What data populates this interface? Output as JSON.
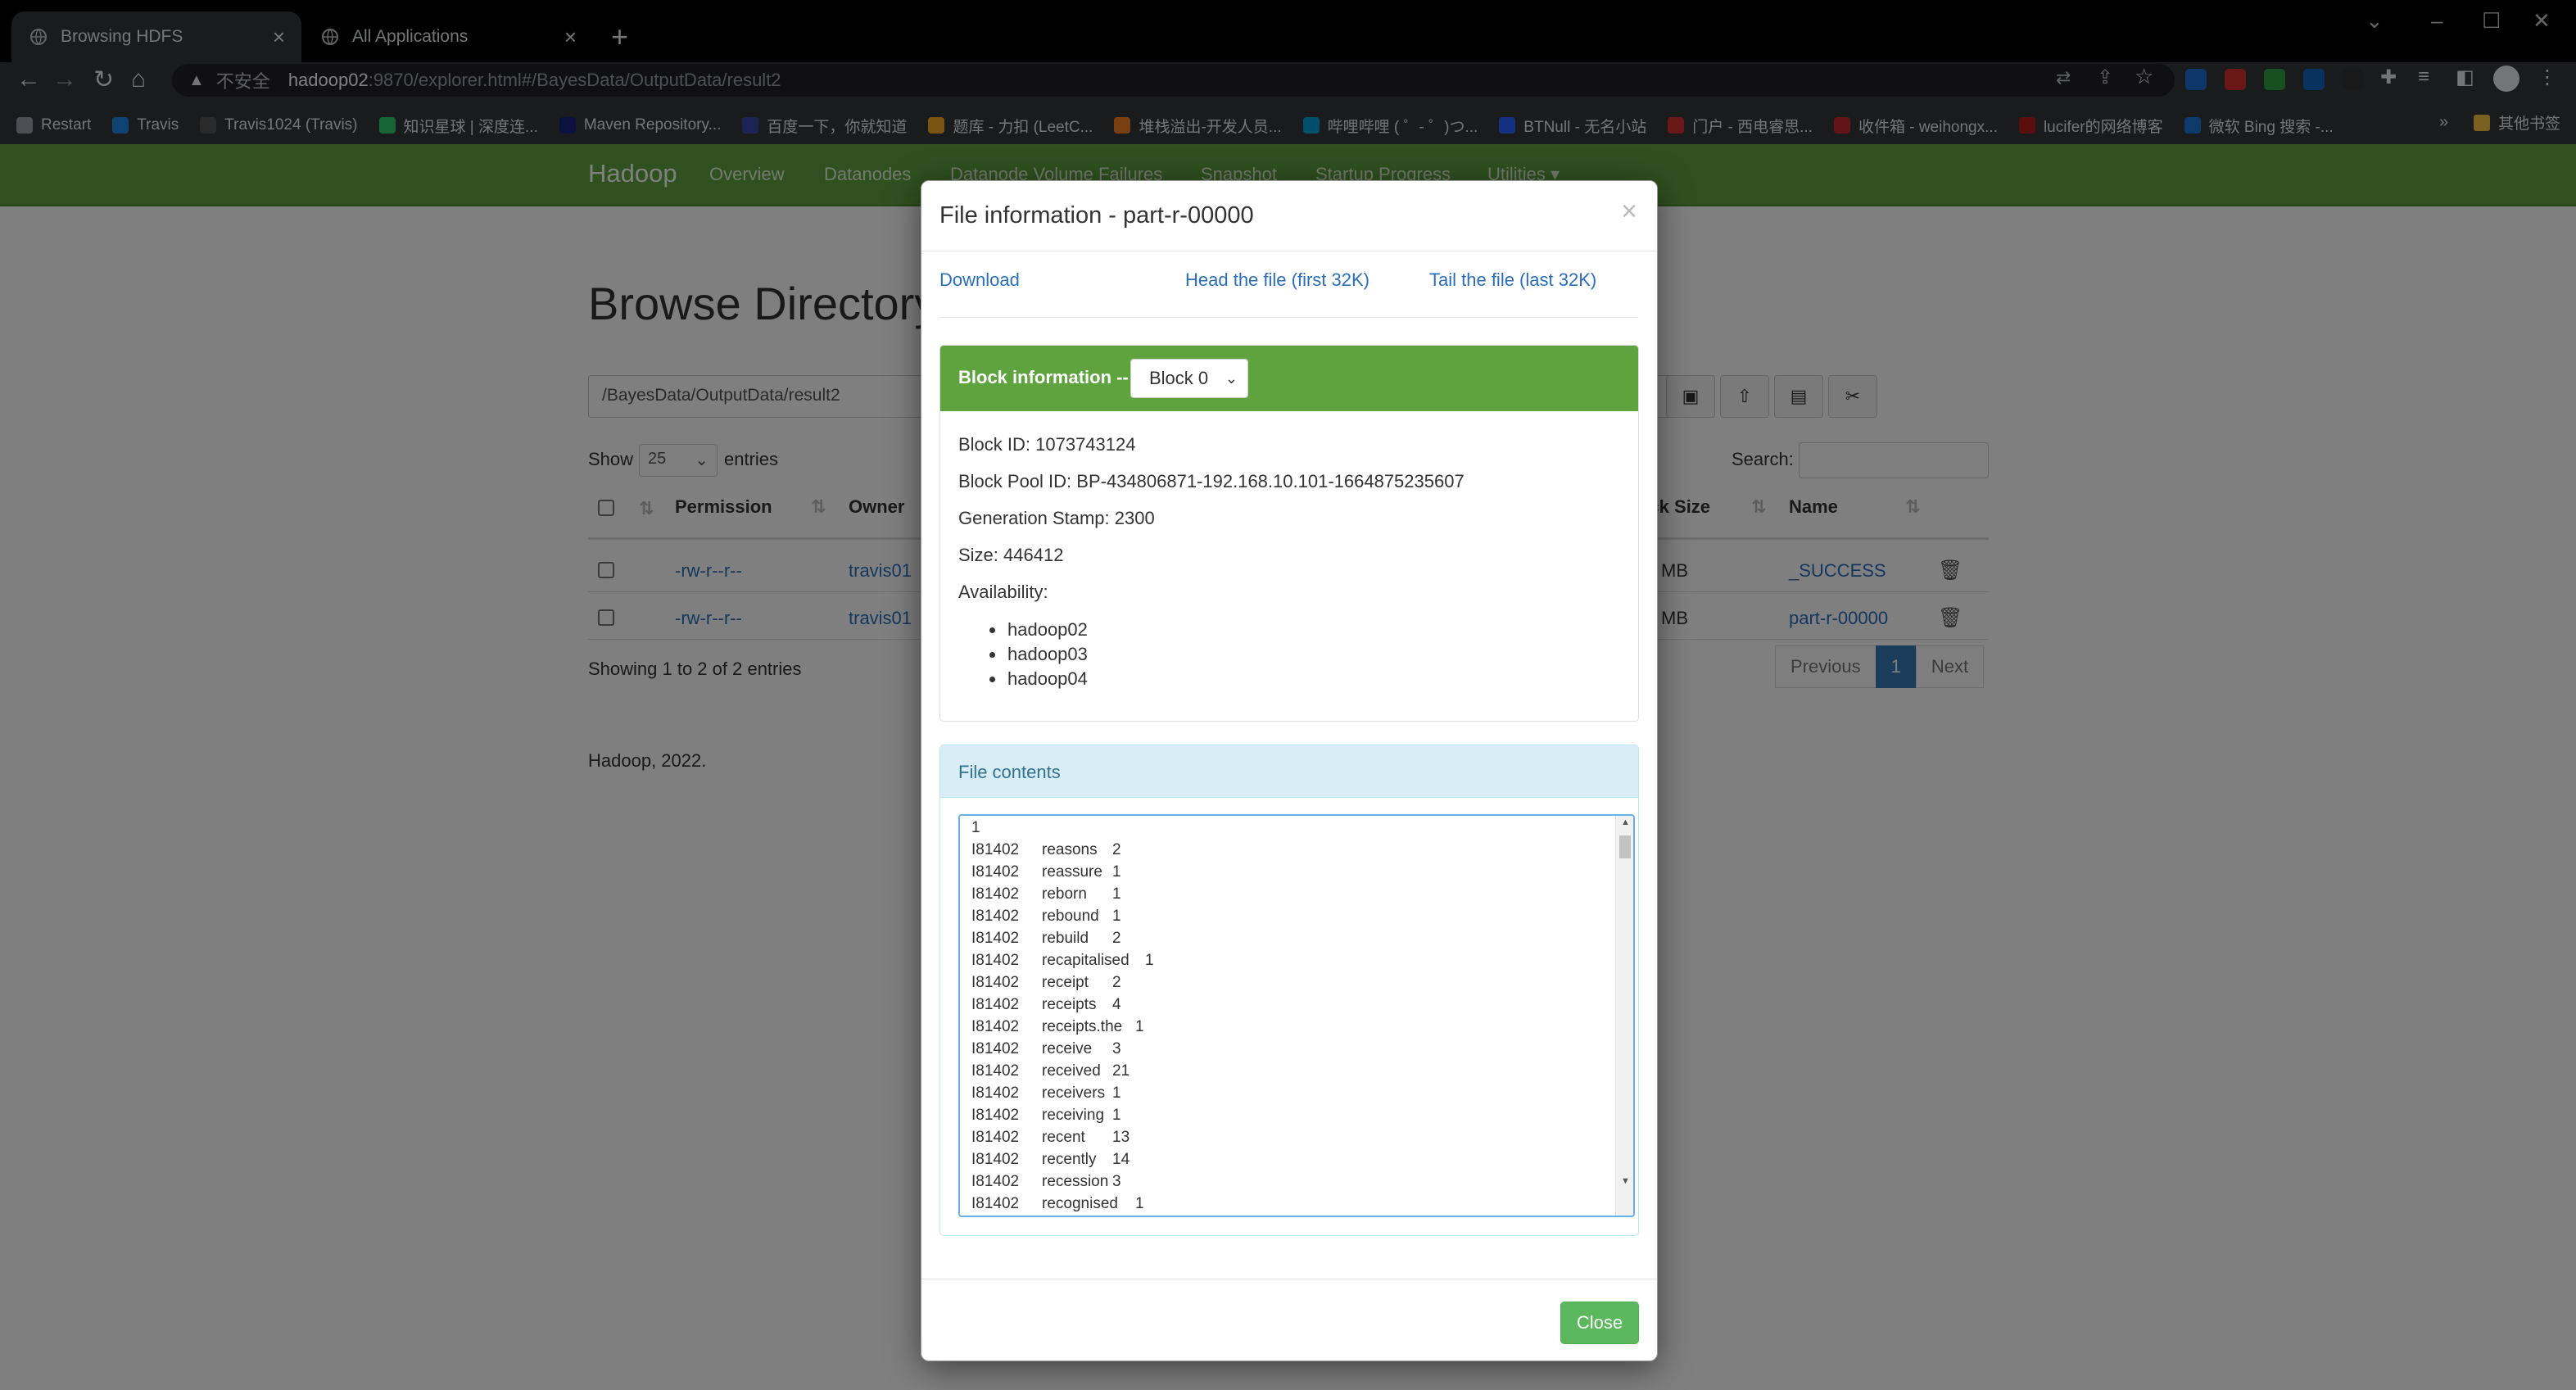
{
  "browser": {
    "tabs": [
      {
        "title": "Browsing HDFS",
        "active": true
      },
      {
        "title": "All Applications",
        "active": false
      }
    ],
    "address": {
      "security_label": "不安全",
      "host": "hadoop02",
      "path": ":9870/explorer.html#/BayesData/OutputData/result2"
    },
    "bookmarks": [
      {
        "label": "Restart",
        "color": "#9aa0a6"
      },
      {
        "label": "Travis",
        "color": "#1e88e5"
      },
      {
        "label": "Travis1024 (Travis)",
        "color": "#555555"
      },
      {
        "label": "知识星球 | 深度连...",
        "color": "#2ecc71"
      },
      {
        "label": "Maven Repository...",
        "color": "#1a237e"
      },
      {
        "label": "百度一下，你就知道",
        "color": "#3949ab"
      },
      {
        "label": "题库 - 力扣 (LeetC...",
        "color": "#f5a623"
      },
      {
        "label": "堆栈溢出-开发人员...",
        "color": "#f48024"
      },
      {
        "label": "哔哩哔哩 ( ゜- ゜)つ...",
        "color": "#00a1d6"
      },
      {
        "label": "BTNull - 无名小站",
        "color": "#2962ff"
      },
      {
        "label": "门户 - 西电睿思...",
        "color": "#d32f2f"
      },
      {
        "label": "收件箱 - weihongx...",
        "color": "#c62828"
      },
      {
        "label": "lucifer的网络博客",
        "color": "#b71c1c"
      },
      {
        "label": "微软 Bing 搜索 -...",
        "color": "#1976d2"
      }
    ],
    "other_bookmarks": "其他书签",
    "overflow": "»"
  },
  "hadoop": {
    "brand": "Hadoop",
    "nav": [
      "Overview",
      "Datanodes",
      "Datanode Volume Failures",
      "Snapshot",
      "Startup Progress",
      "Utilities ▾"
    ],
    "title": "Browse Directory",
    "path_value": "/BayesData/OutputData/result2",
    "show_label": "Show",
    "entries_value": "25",
    "entries_label": "entries",
    "search_label": "Search:",
    "columns": [
      "Permission",
      "Owner",
      "Block Size",
      "Name"
    ],
    "rows": [
      {
        "permission": "-rw-r--r--",
        "owner": "travis01",
        "block_size": "MB",
        "name": "_SUCCESS"
      },
      {
        "permission": "-rw-r--r--",
        "owner": "travis01",
        "block_size": "MB",
        "name": "part-r-00000"
      }
    ],
    "showing": "Showing 1 to 2 of 2 entries",
    "pager": {
      "previous": "Previous",
      "page": "1",
      "next": "Next"
    },
    "footer": "Hadoop, 2022."
  },
  "modal": {
    "title": "File information - part-r-00000",
    "close_x": "×",
    "links": {
      "download": "Download",
      "head": "Head the file (first 32K)",
      "tail": "Tail the file (last 32K)"
    },
    "block": {
      "label": "Block information --",
      "selected": "Block 0",
      "block_id": "Block ID: 1073743124",
      "pool_id": "Block Pool ID: BP-434806871-192.168.10.101-1664875235607",
      "generation": "Generation Stamp: 2300",
      "size": "Size: 446412",
      "availability": "Availability:",
      "hosts": [
        "hadoop02",
        "hadoop03",
        "hadoop04"
      ]
    },
    "contents": {
      "label": "File contents",
      "first_line": "1",
      "lines": [
        {
          "id": "I81402",
          "word": "reasons",
          "count": "2"
        },
        {
          "id": "I81402",
          "word": "reassure",
          "count": "1"
        },
        {
          "id": "I81402",
          "word": "reborn",
          "count": "1"
        },
        {
          "id": "I81402",
          "word": "rebound",
          "count": "1"
        },
        {
          "id": "I81402",
          "word": "rebuild",
          "count": "2"
        },
        {
          "id": "I81402",
          "word": "recapitalised",
          "count": "1"
        },
        {
          "id": "I81402",
          "word": "receipt",
          "count": "2"
        },
        {
          "id": "I81402",
          "word": "receipts",
          "count": "4"
        },
        {
          "id": "I81402",
          "word": "receipts.the",
          "count": "1"
        },
        {
          "id": "I81402",
          "word": "receive",
          "count": "3"
        },
        {
          "id": "I81402",
          "word": "received",
          "count": "21"
        },
        {
          "id": "I81402",
          "word": "receivers",
          "count": "1"
        },
        {
          "id": "I81402",
          "word": "receiving",
          "count": "1"
        },
        {
          "id": "I81402",
          "word": "recent",
          "count": "13"
        },
        {
          "id": "I81402",
          "word": "recently",
          "count": "14"
        },
        {
          "id": "I81402",
          "word": "recession",
          "count": "3"
        },
        {
          "id": "I81402",
          "word": "recognised",
          "count": "1"
        }
      ]
    },
    "close_label": "Close"
  }
}
